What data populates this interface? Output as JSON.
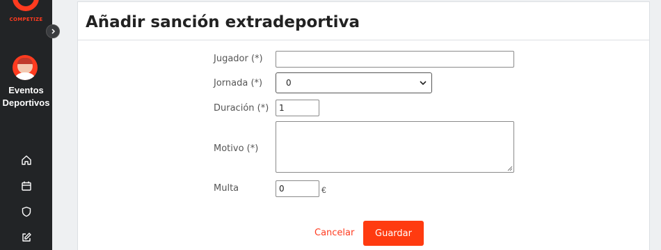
{
  "brand": {
    "logo_text": "COMPETIZE",
    "accent_color": "#ff3b1f"
  },
  "sidebar": {
    "org_name_line1": "Eventos",
    "org_name_line2": "Deportivos",
    "nav_icons": [
      "home-icon",
      "calendar-icon",
      "shield-icon",
      "edit-icon"
    ]
  },
  "form": {
    "title": "Añadir sanción extradeportiva",
    "fields": {
      "player_label": "Jugador (*)",
      "player_value": "",
      "round_label": "Jornada (*)",
      "round_value": "0",
      "duration_label": "Duración (*)",
      "duration_value": "1",
      "reason_label": "Motivo (*)",
      "reason_value": "",
      "fine_label": "Multa",
      "fine_value": "0",
      "fine_unit": "€"
    },
    "actions": {
      "cancel_label": "Cancelar",
      "save_label": "Guardar"
    }
  }
}
